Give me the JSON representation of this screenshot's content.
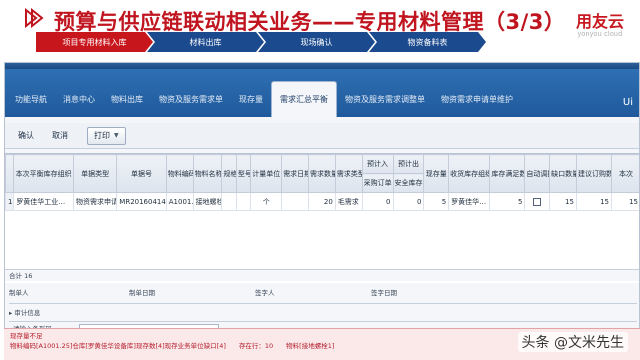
{
  "slide": {
    "title": "预算与供应链联动相关业务——专用材料管理（3/3）",
    "brand_name": "用友云",
    "brand_sub": "yonyou cloud"
  },
  "steps": [
    "项目专用材料入库",
    "材料出库",
    "现场确认",
    "物资备料表"
  ],
  "tabs": [
    "功能导航",
    "消息中心",
    "物料出库",
    "物资及服务需求单",
    "现存量",
    "需求汇总平衡",
    "物资及服务需求调整单",
    "物资需求申请单维护"
  ],
  "tabbar_end": "Ui",
  "toolbar": {
    "confirm": "确认",
    "cancel": "取消",
    "print": "打印"
  },
  "grid": {
    "group_headers": {
      "plan": "预计入",
      "out": "预计出"
    },
    "headers": [
      "本次平衡库存组织",
      "单据类型",
      "单据号",
      "物料编码",
      "物料名称",
      "规格",
      "型号",
      "计量单位",
      "需求日期",
      "需求数量",
      "需求类型",
      "采购订单",
      "安全库存",
      "现存量",
      "收货库存组织",
      "库存满足数量",
      "自动调拨",
      "缺口数量",
      "建议订购数量",
      "本次"
    ],
    "rows": [
      {
        "no": "1",
        "org": "罗黄佳华工业…",
        "bill_type": "物资需求申请",
        "bill_no": "MR20160414000…",
        "code": "A1001.25",
        "name": "接地螺栓1",
        "spec": "",
        "model": "",
        "unit": "个",
        "date": "",
        "qty": "20",
        "demand_type": "毛需求",
        "po": "0",
        "safety": "0",
        "onhand": "5",
        "recv_org": "罗黄佳华…",
        "satisfied": "5",
        "gap": "15",
        "suggest": "15",
        "this": "15"
      }
    ]
  },
  "sum_row": "合计 16",
  "form": {
    "maker": "制单人",
    "make_date": "制单日期",
    "signer": "签字人",
    "sign_date": "签字日期",
    "audit_info": "审计信息",
    "remark_label": "请输入条形码"
  },
  "error": {
    "line1": "现存量不足",
    "line2": "物料编码[A1001.25]仓库[罗黄佳华设备库]现存数[4]现存业务单位缺口[4]　　存在行：10　　物料[接地螺栓1]"
  },
  "watermark": "头条 @文米先生"
}
